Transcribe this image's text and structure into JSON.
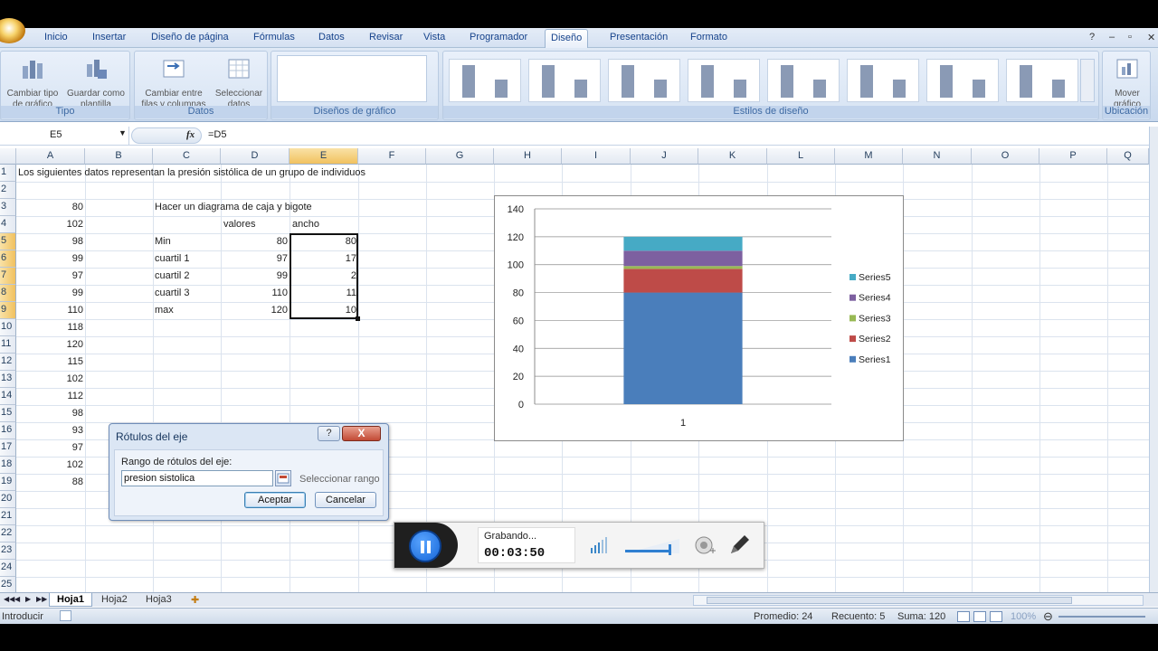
{
  "ribbon_tabs": [
    "Inicio",
    "Insertar",
    "Diseño de página",
    "Fórmulas",
    "Datos",
    "Revisar",
    "Vista",
    "Programador",
    "Diseño",
    "Presentación",
    "Formato"
  ],
  "active_tab": "Diseño",
  "ribbon": {
    "tipo": {
      "title": "Tipo",
      "btn1_l1": "Cambiar tipo",
      "btn1_l2": "de gráfico",
      "btn2_l1": "Guardar como",
      "btn2_l2": "plantilla"
    },
    "datos": {
      "title": "Datos",
      "btn1_l1": "Cambiar entre",
      "btn1_l2": "filas y columnas",
      "btn2_l1": "Seleccionar",
      "btn2_l2": "datos"
    },
    "disenos": {
      "title": "Diseños de gráfico"
    },
    "estilos": {
      "title": "Estilos de diseño"
    },
    "ubicacion": {
      "title": "Ubicación",
      "btn_l1": "Mover",
      "btn_l2": "gráfico"
    }
  },
  "namebox": "E5",
  "fx": "fx",
  "formula": "=D5",
  "columns": [
    "A",
    "B",
    "C",
    "D",
    "E",
    "F",
    "G",
    "H",
    "I",
    "J",
    "K",
    "L",
    "M",
    "N",
    "O",
    "P",
    "Q"
  ],
  "rows": [
    "1",
    "2",
    "3",
    "4",
    "5",
    "6",
    "7",
    "8",
    "9",
    "10",
    "11",
    "12",
    "13",
    "14",
    "15",
    "16",
    "17",
    "18",
    "19",
    "20",
    "21",
    "22",
    "23",
    "24",
    "25"
  ],
  "cells": {
    "a1": "Los siguientes datos representan la presión sistólica  de un grupo de individuos",
    "colA": [
      "80",
      "102",
      "98",
      "99",
      "97",
      "99",
      "110",
      "118",
      "120",
      "115",
      "102",
      "112",
      "98",
      "93",
      "97",
      "102",
      "88"
    ],
    "c3": "Hacer un diagrama de caja y bigote",
    "d4": "valores",
    "e4": "ancho",
    "labels": [
      "Min",
      "cuartil 1",
      "cuartil 2",
      "cuartil 3",
      "max"
    ],
    "valores": [
      "80",
      "97",
      "99",
      "110",
      "120"
    ],
    "ancho": [
      "80",
      "17",
      "2",
      "11",
      "10"
    ]
  },
  "chart_data": {
    "type": "bar",
    "stacked": true,
    "categories": [
      "1"
    ],
    "series": [
      {
        "name": "Series1",
        "values": [
          80
        ],
        "color": "#4a7ebb"
      },
      {
        "name": "Series2",
        "values": [
          17
        ],
        "color": "#be4b48"
      },
      {
        "name": "Series3",
        "values": [
          2
        ],
        "color": "#98b954"
      },
      {
        "name": "Series4",
        "values": [
          11
        ],
        "color": "#7d60a0"
      },
      {
        "name": "Series5",
        "values": [
          10
        ],
        "color": "#46aac5"
      }
    ],
    "ylim": [
      0,
      140
    ],
    "yticks": [
      "0",
      "20",
      "40",
      "60",
      "80",
      "100",
      "120",
      "140"
    ],
    "grid": true,
    "legend": "right"
  },
  "dialog": {
    "title": "Rótulos del eje",
    "help": "?",
    "close": "X",
    "label": "Rango de rótulos del eje:",
    "value": "presion sistolica",
    "hint": "Seleccionar rango",
    "ok": "Aceptar",
    "cancel": "Cancelar"
  },
  "sheet_tabs": [
    "Hoja1",
    "Hoja2",
    "Hoja3"
  ],
  "status": {
    "mode": "Introducir",
    "promedio": "Promedio: 24",
    "recuento": "Recuento: 5",
    "suma": "Suma: 120",
    "zoom": "100%"
  },
  "recorder": {
    "status": "Grabando...",
    "time": "00:03:50"
  }
}
